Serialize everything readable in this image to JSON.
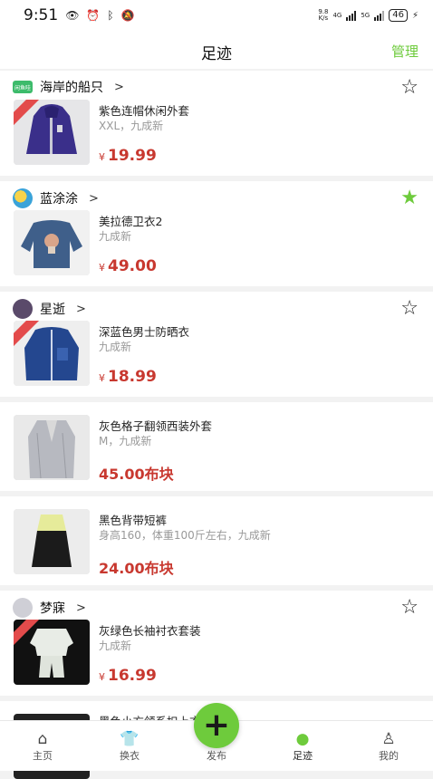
{
  "status_bar": {
    "time": "9:51",
    "net_speed_value": "9.8",
    "net_speed_unit": "K/s",
    "signal_1": "4G",
    "signal_2": "5G",
    "battery": "46"
  },
  "header": {
    "title": "足迹",
    "manage": "管理"
  },
  "items": [
    {
      "seller": "海岸的船只",
      "name": "紫色连帽休闲外套",
      "desc": "XXL，九成新",
      "price_symbol": "¥",
      "price": "19.99",
      "favorited": false
    },
    {
      "seller": "蓝涂涂",
      "name": "美拉德卫衣2",
      "desc": "九成新",
      "price_symbol": "¥",
      "price": "49.00",
      "favorited": true
    },
    {
      "seller": "星逝",
      "name": "深蓝色男士防晒衣",
      "desc": "九成新",
      "price_symbol": "¥",
      "price": "18.99",
      "favorited": false
    },
    {
      "name": "灰色格子翻领西装外套",
      "desc": "M，九成新",
      "price_text": "45.00布块"
    },
    {
      "name": "黑色背带短裤",
      "desc": "身高160，体重100斤左右，九成新",
      "price_text": "24.00布块"
    },
    {
      "seller": "梦寐",
      "name": "灰绿色长袖衬衣套装",
      "desc": "九成新",
      "price_symbol": "¥",
      "price": "16.99",
      "favorited": false
    },
    {
      "name": "黑色小方领系扣上衣"
    }
  ],
  "avatar_badge": "闲鱼哇",
  "tabs": [
    {
      "label": "主页",
      "icon": "home-icon"
    },
    {
      "label": "换衣",
      "icon": "shirt-icon"
    },
    {
      "label": "发布",
      "icon": "plus-icon"
    },
    {
      "label": "足迹",
      "icon": "footprint-icon"
    },
    {
      "label": "我的",
      "icon": "profile-icon"
    }
  ],
  "colors": {
    "accent": "#6ecb3c",
    "price": "#c8382f"
  }
}
